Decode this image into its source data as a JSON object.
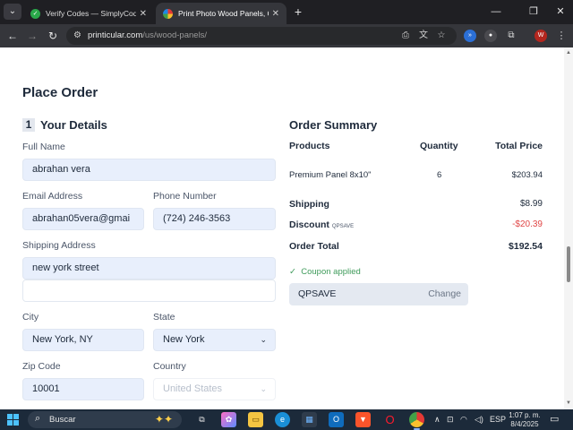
{
  "browser": {
    "tabs": [
      {
        "title": "Verify Codes — SimplyCodes",
        "active": false
      },
      {
        "title": "Print Photo Wood Panels, Custo",
        "active": true
      }
    ],
    "url_host": "printicular.com",
    "url_path": "/us/wood-panels/"
  },
  "page": {
    "heading": "Place Order",
    "details": {
      "step_number": "1",
      "title": "Your Details",
      "full_name_label": "Full Name",
      "full_name": "abrahan vera",
      "email_label": "Email Address",
      "email": "abrahan05vera@gmai",
      "phone_label": "Phone Number",
      "phone": "(724) 246-3563",
      "shipping_label": "Shipping Address",
      "address_line1": "new york street",
      "address_line2": "",
      "city_label": "City",
      "city": "New York, NY",
      "state_label": "State",
      "state": "New York",
      "zip_label": "Zip Code",
      "zip": "10001",
      "country_label": "Country",
      "country": "United States"
    },
    "summary": {
      "title": "Order Summary",
      "col_products": "Products",
      "col_quantity": "Quantity",
      "col_total": "Total Price",
      "item_name": "Premium Panel 8x10\"",
      "item_qty": "6",
      "item_total": "$203.94",
      "shipping_label": "Shipping",
      "shipping_value": "$8.99",
      "discount_label": "Discount",
      "discount_code": "QPSAVE",
      "discount_value": "-$20.39",
      "order_total_label": "Order Total",
      "order_total_value": "$192.54",
      "coupon_status": "Coupon applied",
      "coupon_code": "QPSAVE",
      "coupon_change": "Change"
    }
  },
  "taskbar": {
    "search_placeholder": "Buscar",
    "language": "ESP",
    "time": "1:07 p. m.",
    "date": "8/4/2025"
  },
  "colors": {
    "accent_field": "#e8effc",
    "discount": "#e04646",
    "success": "#3f9b5b",
    "heading": "#1e2a3b"
  }
}
